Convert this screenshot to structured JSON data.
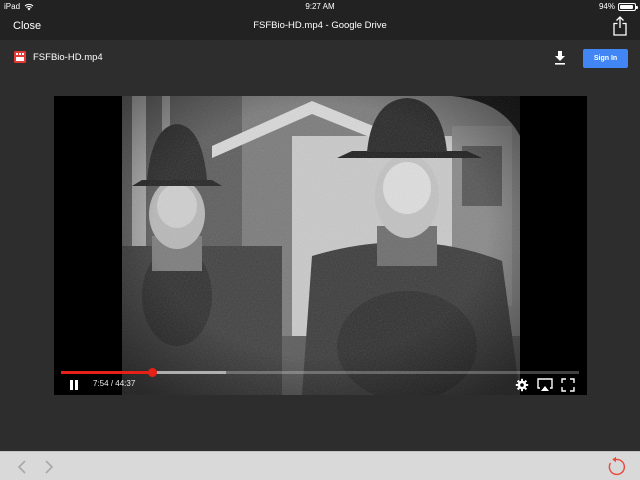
{
  "status_bar": {
    "device": "iPad",
    "time": "9:27 AM",
    "battery": "94%",
    "battery_level": 0.94
  },
  "nav_bar": {
    "close_label": "Close",
    "title": "FSFBio-HD.mp4 - Google Drive"
  },
  "drive_header": {
    "file_name": "FSFBio-HD.mp4",
    "signin_label": "Sign In",
    "accent_color": "#4285f4"
  },
  "player": {
    "current_time": "7:54",
    "separator": "/",
    "duration": "44:37",
    "played_fraction": 0.177,
    "buffered_fraction": 0.318,
    "progress_color": "#e62117"
  },
  "icons": {
    "share": "share-icon",
    "file": "video-file-icon",
    "download": "download-icon",
    "pause": "pause-icon",
    "settings": "gear-icon",
    "airplay": "airplay-icon",
    "fullscreen": "fullscreen-icon",
    "back": "chevron-left-icon",
    "forward": "chevron-right-icon",
    "reload": "reload-icon"
  }
}
